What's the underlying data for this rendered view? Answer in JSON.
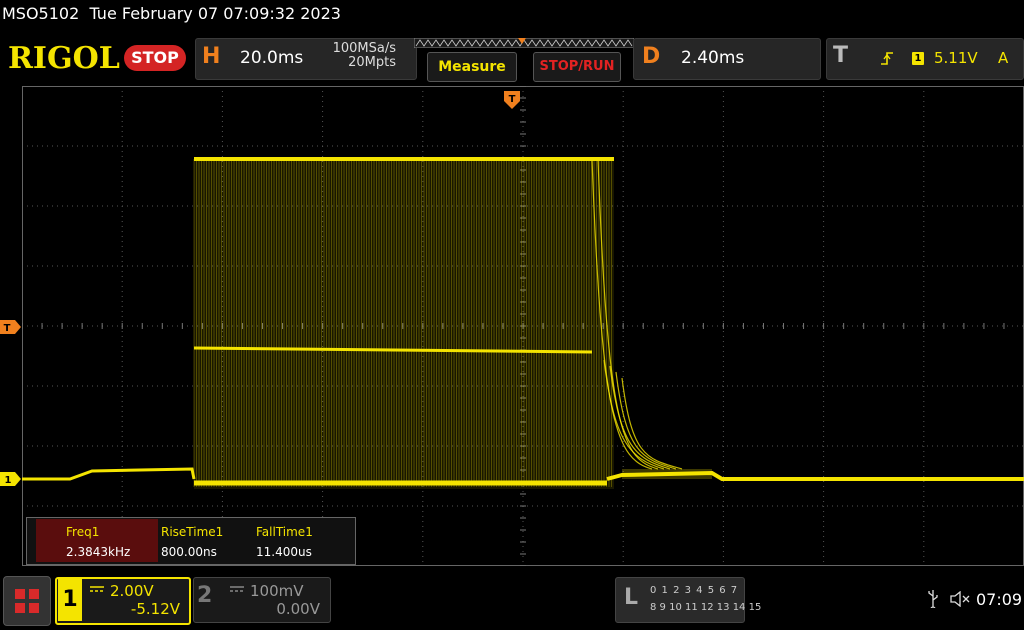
{
  "title_bar": {
    "model": "MSO5102",
    "datetime": "Tue February 07 07:09:32 2023"
  },
  "header": {
    "brand": "RIGOL",
    "run_state": "STOP",
    "horizontal": {
      "letter": "H",
      "timebase": "20.0ms",
      "sample_rate": "100MSa/s",
      "memory_depth": "20Mpts"
    },
    "measure_label": "Measure",
    "stop_run_label": "STOP/RUN",
    "delay": {
      "letter": "D",
      "value": "2.40ms"
    },
    "trigger": {
      "letter": "T",
      "channel": "1",
      "level": "5.11V",
      "mode": "A",
      "edge": "rising-edge-icon"
    }
  },
  "markers": {
    "trigger_position": "T",
    "trigger_level": "T",
    "channel1": "1"
  },
  "measurements": [
    {
      "name": "Freq1",
      "value": "2.3843kHz"
    },
    {
      "name": "RiseTime1",
      "value": "800.00ns"
    },
    {
      "name": "FallTime1",
      "value": "11.400us"
    }
  ],
  "channels": [
    {
      "number": "1",
      "scale": "2.00V",
      "offset": "-5.12V",
      "active": true,
      "color": "#f4e400"
    },
    {
      "number": "2",
      "scale": "100mV",
      "offset": "0.00V",
      "active": false,
      "color": "#888888"
    }
  ],
  "logic_analyzer": {
    "letter": "L",
    "row1": "0 1 2 3  4 5 6 7",
    "row2": "8 9 10 11 12 13 14 15"
  },
  "status": {
    "time": "07:09",
    "icons": [
      "usb-icon",
      "sound-muted-icon"
    ]
  },
  "colors": {
    "trace": "#f4e400",
    "accent": "#f0801e",
    "stop": "#d42424"
  }
}
